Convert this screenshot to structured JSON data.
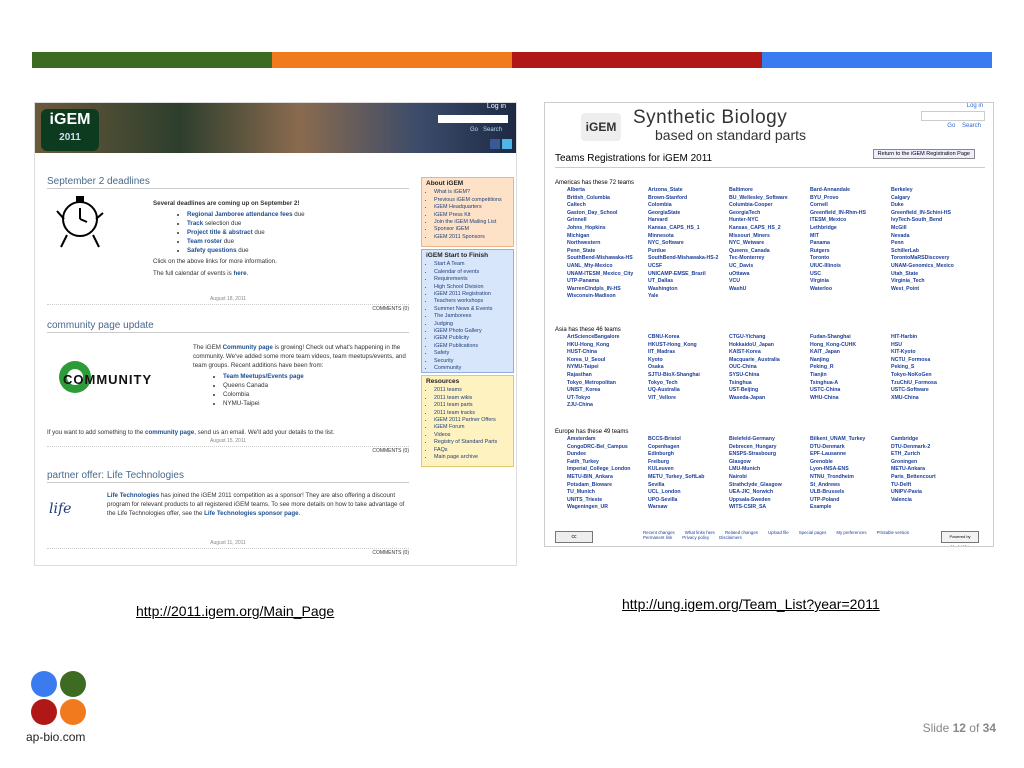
{
  "colorbar": {
    "segments": [
      {
        "color": "#3d6b21",
        "name": "green"
      },
      {
        "color": "#f27a1e",
        "name": "orange"
      },
      {
        "color": "#b01818",
        "name": "red"
      },
      {
        "color": "#3a7cf0",
        "name": "blue"
      }
    ]
  },
  "left_shot": {
    "logo": "iGEM",
    "logo_year": "2011",
    "login": "Log in",
    "go": "Go",
    "search": "Search",
    "post1": {
      "title": "September 2 deadlines",
      "intro": "Several deadlines are coming up on September 2!",
      "items": [
        {
          "link": "Regional Jamboree attendance fees",
          "rest": " due"
        },
        {
          "link": "Track",
          "rest": " selection due"
        },
        {
          "link": "Project title & abstract",
          "rest": " due"
        },
        {
          "link": "Team roster",
          "rest": " due"
        },
        {
          "link": "Safety questions",
          "rest": " due"
        }
      ],
      "click": "Click on the above links for more information.",
      "calendar_prefix": "The full calendar of events is ",
      "calendar_link": "here",
      "calendar_suffix": ".",
      "date": "August 18, 2011",
      "comments": "COMMENTS (0)"
    },
    "post2": {
      "title": "community page update",
      "logo_text": "COMMUNITY",
      "text_prefix": "The iGEM ",
      "text_link": "Community page",
      "text_rest": " is growing! Check out what's happening in the community. We've added some more team videos, team meetups/events, and team groups. Recent additions have been from:",
      "items": [
        {
          "link": "Team Meetups/Events page",
          "plain": ""
        },
        {
          "link": "",
          "plain": "Queens Canada"
        },
        {
          "link": "",
          "plain": "Colombia"
        },
        {
          "link": "",
          "plain": "NYMU-Taipei"
        }
      ],
      "footer_prefix": "If you want to add something to the ",
      "footer_link": "community page",
      "footer_rest": ", send us an email. We'll add your details to the list.",
      "date": "August 15, 2011",
      "comments": "COMMENTS (0)"
    },
    "post3": {
      "title": "partner offer: Life Technologies",
      "logo_text": "life",
      "link1": "Life Technologies",
      "text": " has joined the iGEM 2011 competition as a sponsor! They are also offering a discount program for relevant products to all registered iGEM teams. To see more details on how to take advantage of the Life Technologies offer, see the ",
      "link2": "Life Technologies sponsor page",
      "end": ".",
      "date": "August 11, 2011",
      "comments": "COMMENTS (0)"
    },
    "sidebar": {
      "about": {
        "title": "About iGEM",
        "items": [
          "What is iGEM?",
          "Previous iGEM competitions",
          "iGEM Headquarters",
          "iGEM Press Kit",
          "Join the iGEM Mailing List",
          "Sponsor iGEM",
          "iGEM 2011 Sponsors"
        ]
      },
      "start": {
        "title": "iGEM Start to Finish",
        "items": [
          "Start A Team",
          "Calendar of events",
          "Requirements",
          "High School Division",
          "iGEM 2011 Registration",
          "Teachers workshops",
          "Summer News & Events",
          "The Jamborees",
          "Judging",
          "iGEM Photo Gallery",
          "iGEM Publicity",
          "iGEM Publications",
          "Safety",
          "Security",
          "Community"
        ]
      },
      "resources": {
        "title": "Resources",
        "items": [
          "2011 teams",
          "2011 team wikis",
          "2011 team parts",
          "2011 team tracks",
          "iGEM 2011 Partner Offers",
          "iGEM Forum",
          "Videos",
          "Registry of Standard Parts",
          "FAQs",
          "Main page archive"
        ]
      }
    }
  },
  "right_shot": {
    "logo": "iGEM",
    "title1": "Synthetic Biology",
    "title2": "based on standard parts",
    "login": "Log in",
    "go": "Go",
    "search": "Search",
    "page_title": "Teams Registrations for iGEM 2011",
    "return_btn": "Return to the iGEM Registration Page",
    "americas": {
      "title": "Americas has these 72 teams",
      "teams": [
        "Alberta",
        "Arizona_State",
        "Baltimore",
        "Bard-Annandale",
        "Berkeley",
        "British_Columbia",
        "Brown-Stanford",
        "BU_Wellesley_Software",
        "BYU_Provo",
        "Calgary",
        "Caltech",
        "Colombia",
        "Columbia-Cooper",
        "Cornell",
        "Duke",
        "Gaston_Day_School",
        "GeorgiaState",
        "GeorgiaTech",
        "Greenfield_IN-Rhm-HS",
        "Greenfield_IN-Schini-HS",
        "Grinnell",
        "Harvard",
        "Hunter-NYC",
        "ITESM_Mexico",
        "IvyTech-South_Bend",
        "Johns_Hopkins",
        "Kansas_CAPS_HS_1",
        "Kansas_CAPS_HS_2",
        "Lethbridge",
        "McGill",
        "Michigan",
        "Minnesota",
        "Missouri_Miners",
        "MIT",
        "Nevada",
        "Northwestern",
        "NYC_Software",
        "NYC_Wetware",
        "Panama",
        "Penn",
        "Penn_State",
        "Purdue",
        "Queens_Canada",
        "Rutgers",
        "SchillerLab",
        "SouthBend-Mishawaka-HS",
        "SouthBend-Mishawaka-HS-2",
        "Tec-Monterrey",
        "Toronto",
        "TorontoMaRSDiscovery",
        "UANL_Mty-Mexico",
        "UCSF",
        "UC_Davis",
        "UIUC-Illinois",
        "UNAM-Genomics_Mexico",
        "UNAM-ITESM_Mexico_City",
        "UNICAMP-EMSE_Brazil",
        "uOttawa",
        "USC",
        "Utah_State",
        "UTP-Panama",
        "UT_Dallas",
        "VCU",
        "Virginia",
        "Virginia_Tech",
        "WarrenCIndpls_IN-HS",
        "Washington",
        "WashU",
        "Waterloo",
        "West_Point",
        "Wisconsin-Madison",
        "Yale"
      ]
    },
    "asia": {
      "title": "Asia has these 46 teams",
      "teams": [
        "ArtScienceBangalore",
        "CBNU-Korea",
        "CTGU-Yichang",
        "Fudan-Shanghai",
        "HIT-Harbin",
        "HKU-Hong_Kong",
        "HKUST-Hong_Kong",
        "HokkaidoU_Japan",
        "Hong_Kong-CUHK",
        "HSU",
        "HUST-China",
        "IIT_Madras",
        "KAIST-Korea",
        "KAIT_Japan",
        "KIT-Kyoto",
        "Korea_U_Seoul",
        "Kyoto",
        "Macquarie_Australia",
        "Nanjing",
        "NCTU_Formosa",
        "NYMU-Taipei",
        "Osaka",
        "OUC-China",
        "Peking_R",
        "Peking_S",
        "Rajasthan",
        "SJTU-BioX-Shanghai",
        "SYSU-China",
        "Tianjin",
        "Tokyo-NoKoGen",
        "Tokyo_Metropolitan",
        "Tokyo_Tech",
        "Tsinghua",
        "Tsinghua-A",
        "TzuChiU_Formosa",
        "UNIST_Korea",
        "UQ-Australia",
        "UST-Beijing",
        "USTC-China",
        "USTC-Software",
        "UT-Tokyo",
        "VIT_Vellore",
        "Waseda-Japan",
        "WHU-China",
        "XMU-China",
        "ZJU-China"
      ]
    },
    "europe": {
      "title": "Europe has these 49 teams",
      "teams": [
        "Amsterdam",
        "BCCS-Bristol",
        "Bielefeld-Germany",
        "Bilkent_UNAM_Turkey",
        "Cambridge",
        "CongoDRC-Bel_Campus",
        "Copenhagen",
        "Debrecen_Hungary",
        "DTU-Denmark",
        "DTU-Denmark-2",
        "Dundee",
        "Edinburgh",
        "ENSPS-Strasbourg",
        "EPF-Lausanne",
        "ETH_Zurich",
        "Fatih_Turkey",
        "Freiburg",
        "Glasgow",
        "Grenoble",
        "Groningen",
        "Imperial_College_London",
        "KULeuven",
        "LMU-Munich",
        "Lyon-INSA-ENS",
        "METU-Ankara",
        "METU-BIN_Ankara",
        "METU_Turkey_SoftLab",
        "Nairobi",
        "NTNU_Trondheim",
        "Paris_Bettencourt",
        "Potsdam_Bioware",
        "Sevilla",
        "Strathclyde_Glasgow",
        "St_Andrews",
        "TU-Delft",
        "TU_Munich",
        "UCL_London",
        "UEA-JIC_Norwich",
        "ULB-Brussels",
        "UNIPV-Pavia",
        "UNITS_Trieste",
        "UPO-Sevilla",
        "Uppsala-Sweden",
        "UTP-Poland",
        "Valencia",
        "Wageningen_UR",
        "Warsaw",
        "WITS-CSIR_SA",
        "Example"
      ]
    },
    "footer": {
      "cc": "cc",
      "links": [
        "Recent changes",
        "What links here",
        "Related changes",
        "Upload file",
        "Special pages",
        "My preferences",
        "Printable version",
        "Permanent link",
        "Privacy policy",
        "Disclaimers"
      ],
      "mediawiki": "Powered by MediaWiki"
    }
  },
  "urls": {
    "left": "http://2011.igem.org/Main_Page",
    "right": "http://ung.igem.org/Team_List?year=2011"
  },
  "brand": {
    "text": "ap-bio.com",
    "colors": [
      "#3a7cf0",
      "#3d6b21",
      "#b01818",
      "#f27a1e"
    ]
  },
  "slide": {
    "prefix": "Slide ",
    "current": "12",
    "of": " of ",
    "total": "34"
  }
}
